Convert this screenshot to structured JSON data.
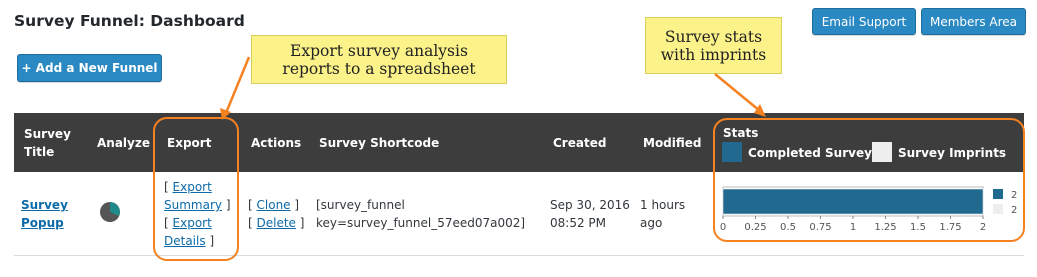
{
  "page": {
    "title": "Survey Funnel: Dashboard"
  },
  "header_buttons": {
    "email_support": "Email Support",
    "members_area": "Members Area"
  },
  "add_button": "+ Add a New Funnel",
  "callouts": {
    "export": [
      "Export survey analysis",
      "reports to a spreadsheet"
    ],
    "stats": [
      "Survey stats",
      "with imprints"
    ]
  },
  "table": {
    "headers": {
      "survey_title": [
        "Survey",
        "Title"
      ],
      "analyze": "Analyze",
      "export": "Export",
      "actions": "Actions",
      "shortcode": "Survey Shortcode",
      "created": "Created",
      "modified": "Modified",
      "stats": "Stats"
    },
    "legend": {
      "completed": {
        "label": "Completed Surveys",
        "color": "#21698f"
      },
      "imprints": {
        "label": "Survey Imprints",
        "color": "#eeeeee"
      }
    },
    "row": {
      "title": [
        "Survey",
        "Popup"
      ],
      "export": {
        "open1": "[",
        "summary": [
          "Export",
          "Summary"
        ],
        "close1": "]",
        "open2": "[",
        "details": [
          "Export",
          "Details"
        ],
        "close2": "]"
      },
      "actions": {
        "open1": "[",
        "clone": "Clone",
        "close1": "]",
        "open2": "[",
        "delete": "Delete",
        "close2": "]"
      },
      "shortcode": [
        "[survey_funnel",
        "key=survey_funnel_57eed07a002]"
      ],
      "created": [
        "Sep 30, 2016",
        "08:52 PM"
      ],
      "modified": [
        "1 hours",
        "ago"
      ]
    }
  },
  "pie_colors": {
    "main": "#555555",
    "slice": "#1f8a8a"
  },
  "chart_data": {
    "type": "bar",
    "orientation": "horizontal",
    "series": [
      {
        "name": "Completed Surveys",
        "value": 2,
        "color": "#21698f"
      },
      {
        "name": "Survey Imprints",
        "value": 2,
        "color": "#eeeeee"
      }
    ],
    "legend_labels": [
      "2",
      "2"
    ],
    "xlim": [
      0,
      2
    ],
    "ticks": [
      "0",
      "0.25",
      "0.5",
      "0.75",
      "1",
      "1.25",
      "1.5",
      "1.75",
      "2"
    ]
  }
}
